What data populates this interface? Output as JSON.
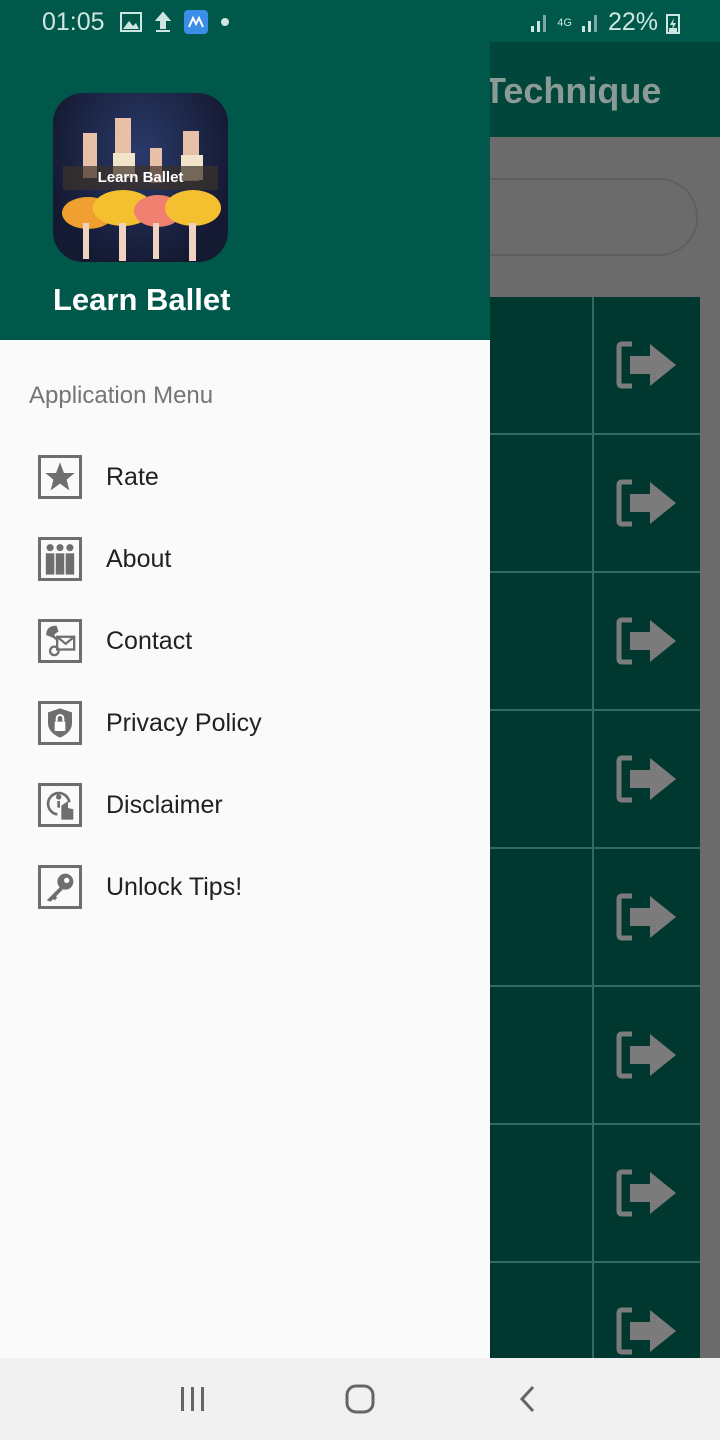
{
  "status_bar": {
    "time": "01:05",
    "battery": "22%",
    "network": "4G"
  },
  "background_screen": {
    "title": "Technique",
    "row_count": 8,
    "row_icon": "exit-arrow-icon"
  },
  "drawer": {
    "app_name": "Learn Ballet",
    "logo_caption": "Learn Ballet",
    "section_title": "Application Menu",
    "items": [
      {
        "label": "Rate",
        "icon": "star-icon"
      },
      {
        "label": "About",
        "icon": "people-icon"
      },
      {
        "label": "Contact",
        "icon": "contact-icon"
      },
      {
        "label": "Privacy Policy",
        "icon": "shield-lock-icon"
      },
      {
        "label": "Disclaimer",
        "icon": "info-icon"
      },
      {
        "label": "Unlock Tips!",
        "icon": "key-icon"
      }
    ]
  },
  "colors": {
    "primary": "#00584a",
    "dark_row": "#00382f",
    "icon_gray": "#6e6e6e"
  }
}
